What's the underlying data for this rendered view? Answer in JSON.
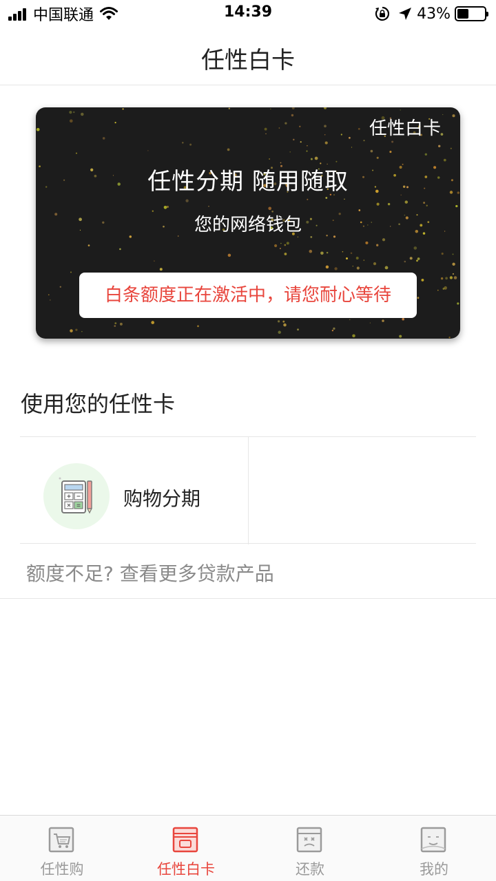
{
  "status_bar": {
    "carrier": "中国联通",
    "time": "14:39",
    "battery_percent": "43%",
    "battery_level": 0.43
  },
  "nav": {
    "title": "任性白卡"
  },
  "card": {
    "brand": "任性白卡",
    "slogan": "任性分期  随用随取",
    "subtitle": "您的网络钱包",
    "status_message": "白条额度正在激活中，请您耐心等待",
    "background_color": "#1c1c1c",
    "status_color": "#e8453c"
  },
  "section": {
    "title": "使用您的任性卡",
    "items": [
      {
        "label": "购物分期",
        "icon": "calculator-icon"
      }
    ]
  },
  "more_link": {
    "label": "额度不足? 查看更多贷款产品"
  },
  "tab_bar": {
    "active_color": "#e8453c",
    "inactive_color": "#9a9a9a",
    "tabs": [
      {
        "label": "任性购",
        "icon": "shopping-cart-icon",
        "active": false
      },
      {
        "label": "任性白卡",
        "icon": "card-icon",
        "active": true
      },
      {
        "label": "还款",
        "icon": "repay-icon",
        "active": false
      },
      {
        "label": "我的",
        "icon": "profile-icon",
        "active": false
      }
    ]
  }
}
